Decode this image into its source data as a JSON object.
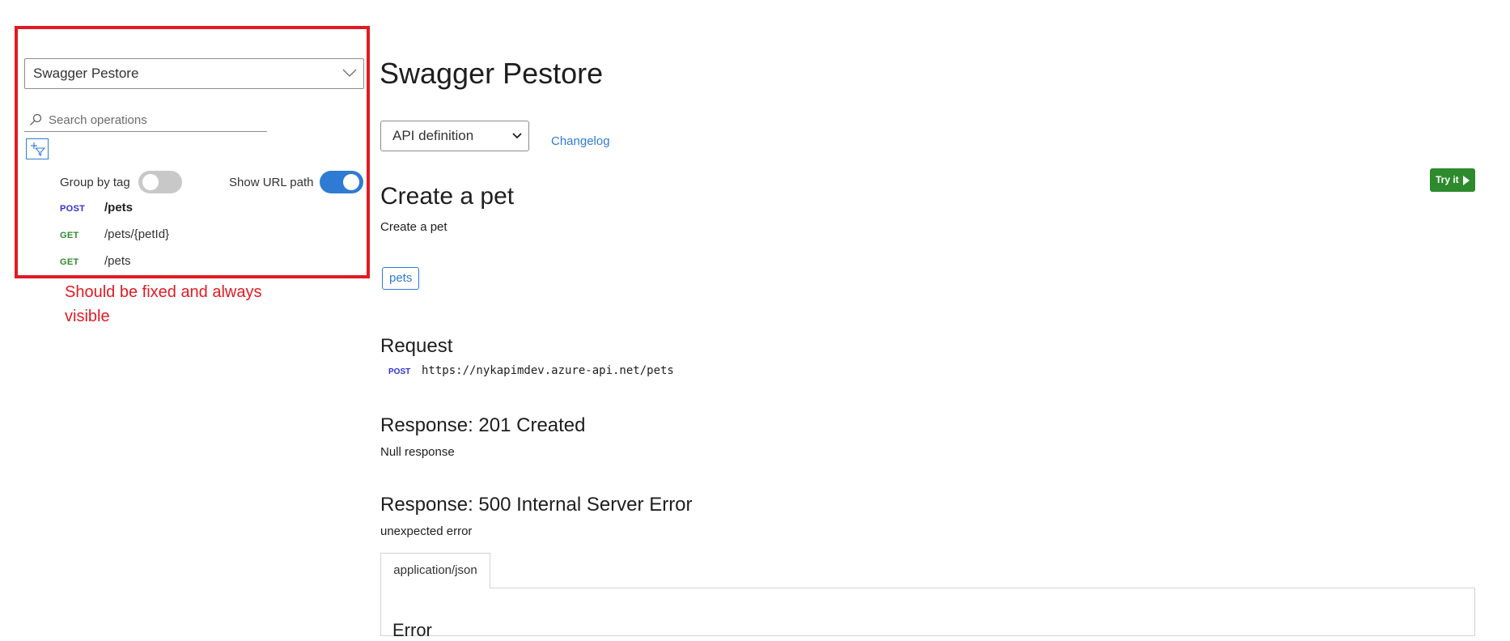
{
  "annotation": {
    "note": "Should be fixed and always visible",
    "color": "#e01b24"
  },
  "sidebar": {
    "api_select_value": "Swagger Pestore",
    "search_placeholder": "Search operations",
    "search_value": "",
    "group_by_tag": {
      "label": "Group by tag",
      "on": false
    },
    "show_url_path": {
      "label": "Show URL path",
      "on": true
    },
    "operations": [
      {
        "method": "POST",
        "path": "/pets",
        "active": true
      },
      {
        "method": "GET",
        "path": "/pets/{petId}",
        "active": false
      },
      {
        "method": "GET",
        "path": "/pets",
        "active": false
      }
    ]
  },
  "main": {
    "title": "Swagger Pestore",
    "definition_select_value": "API definition",
    "changelog_label": "Changelog",
    "try_it_label": "Try it",
    "operation": {
      "title": "Create a pet",
      "description": "Create a pet",
      "tag": "pets"
    },
    "request": {
      "heading": "Request",
      "method": "POST",
      "url": "https://nykapimdev.azure-api.net/pets"
    },
    "responses": [
      {
        "heading": "Response: 201 Created",
        "text": "Null response"
      },
      {
        "heading": "Response: 500 Internal Server Error",
        "text": "unexpected error"
      }
    ],
    "content_tab": "application/json",
    "panel_heading": "Error"
  },
  "colors": {
    "accent": "#2f7bd3",
    "post": "#2f2fd3",
    "get": "#2d8a2d",
    "try_it": "#2d8a2d"
  }
}
